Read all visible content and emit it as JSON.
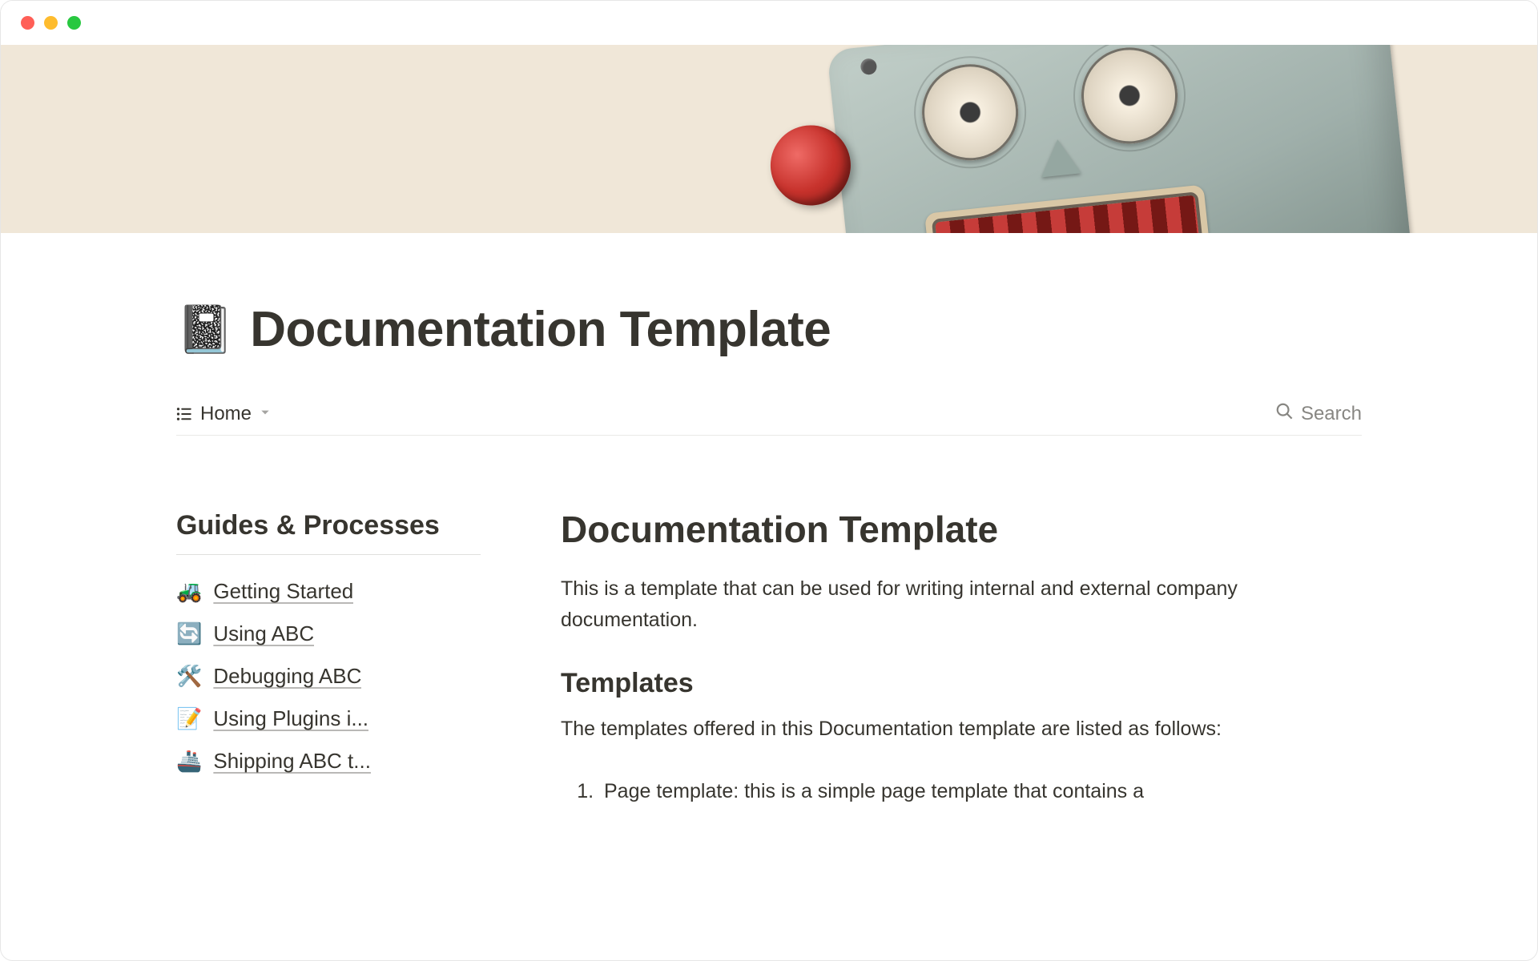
{
  "page": {
    "icon": "📓",
    "title": "Documentation Template"
  },
  "toolbar": {
    "view_label": "Home",
    "search_label": "Search"
  },
  "sidebar": {
    "title": "Guides & Processes",
    "items": [
      {
        "emoji": "🚜",
        "label": "Getting Started"
      },
      {
        "emoji": "🔄",
        "label": "Using ABC"
      },
      {
        "emoji": "🛠️",
        "label": "Debugging ABC"
      },
      {
        "emoji": "📝",
        "label": "Using Plugins i..."
      },
      {
        "emoji": "🚢",
        "label": "Shipping ABC t..."
      }
    ]
  },
  "article": {
    "title": "Documentation Template",
    "intro": "This is a template that can be used for writing internal and external company documentation.",
    "section_title": "Templates",
    "section_intro": "The templates offered in this Documentation template are listed as follows:",
    "list_item_1": "Page template: this is a simple page template that contains a"
  }
}
